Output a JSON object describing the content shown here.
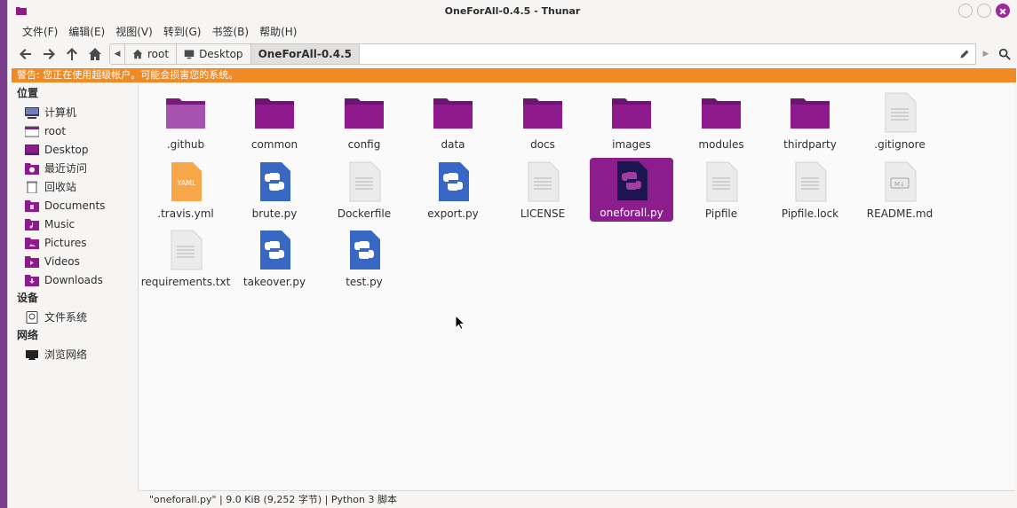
{
  "window": {
    "title": "OneForAll-0.4.5 - Thunar"
  },
  "menubar": [
    {
      "label": "文件(F)"
    },
    {
      "label": "编辑(E)"
    },
    {
      "label": "视图(V)"
    },
    {
      "label": "转到(G)"
    },
    {
      "label": "书签(B)"
    },
    {
      "label": "帮助(H)"
    }
  ],
  "toolbar": {
    "breadcrumbs": [
      {
        "label": "root",
        "icon": "home-icon"
      },
      {
        "label": "Desktop",
        "icon": "desktop-icon"
      },
      {
        "label": "OneForAll-0.4.5",
        "active": true
      }
    ]
  },
  "warning": "警告: 您正在使用超级帐户。可能会损害您的系统。",
  "sidebar": {
    "places_heading": "位置",
    "places": [
      {
        "label": "计算机",
        "icon": "computer-icon"
      },
      {
        "label": "root",
        "icon": "home-folder-icon"
      },
      {
        "label": "Desktop",
        "icon": "desktop-folder-icon"
      },
      {
        "label": "最近访问",
        "icon": "recent-icon"
      },
      {
        "label": "回收站",
        "icon": "trash-icon"
      },
      {
        "label": "Documents",
        "icon": "documents-folder-icon"
      },
      {
        "label": "Music",
        "icon": "music-folder-icon"
      },
      {
        "label": "Pictures",
        "icon": "pictures-folder-icon"
      },
      {
        "label": "Videos",
        "icon": "videos-folder-icon"
      },
      {
        "label": "Downloads",
        "icon": "downloads-folder-icon"
      }
    ],
    "devices_heading": "设备",
    "devices": [
      {
        "label": "文件系统",
        "icon": "drive-icon"
      }
    ],
    "network_heading": "网络",
    "network": [
      {
        "label": "浏览网络",
        "icon": "network-icon"
      }
    ]
  },
  "files": [
    {
      "name": ".github",
      "icon": "folder-icon"
    },
    {
      "name": "common",
      "icon": "folder-icon"
    },
    {
      "name": "config",
      "icon": "folder-icon"
    },
    {
      "name": "data",
      "icon": "folder-icon"
    },
    {
      "name": "docs",
      "icon": "folder-icon"
    },
    {
      "name": "images",
      "icon": "folder-icon"
    },
    {
      "name": "modules",
      "icon": "folder-icon"
    },
    {
      "name": "thirdparty",
      "icon": "folder-icon"
    },
    {
      "name": ".gitignore",
      "icon": "text-file-icon"
    },
    {
      "name": ".travis.yml",
      "icon": "yaml-file-icon",
      "badge": "YAML"
    },
    {
      "name": "brute.py",
      "icon": "python-file-icon"
    },
    {
      "name": "Dockerfile",
      "icon": "text-file-icon"
    },
    {
      "name": "export.py",
      "icon": "python-file-icon"
    },
    {
      "name": "LICENSE",
      "icon": "text-file-icon"
    },
    {
      "name": "oneforall.py",
      "icon": "python-file-icon",
      "selected": true
    },
    {
      "name": "Pipfile",
      "icon": "text-file-icon"
    },
    {
      "name": "Pipfile.lock",
      "icon": "text-file-icon"
    },
    {
      "name": "README.md",
      "icon": "markdown-file-icon",
      "badge": "M↓"
    },
    {
      "name": "requirements.txt",
      "icon": "text-file-icon"
    },
    {
      "name": "takeover.py",
      "icon": "python-file-icon"
    },
    {
      "name": "test.py",
      "icon": "python-file-icon"
    }
  ],
  "statusbar": "\"oneforall.py\" | 9.0 KiB (9,252 字节) | Python 3 脚本",
  "colors": {
    "accent": "#8b1e8c",
    "folder": "#8e1a8e",
    "warning_bg": "#f08a24",
    "python_blue": "#3868c4"
  }
}
